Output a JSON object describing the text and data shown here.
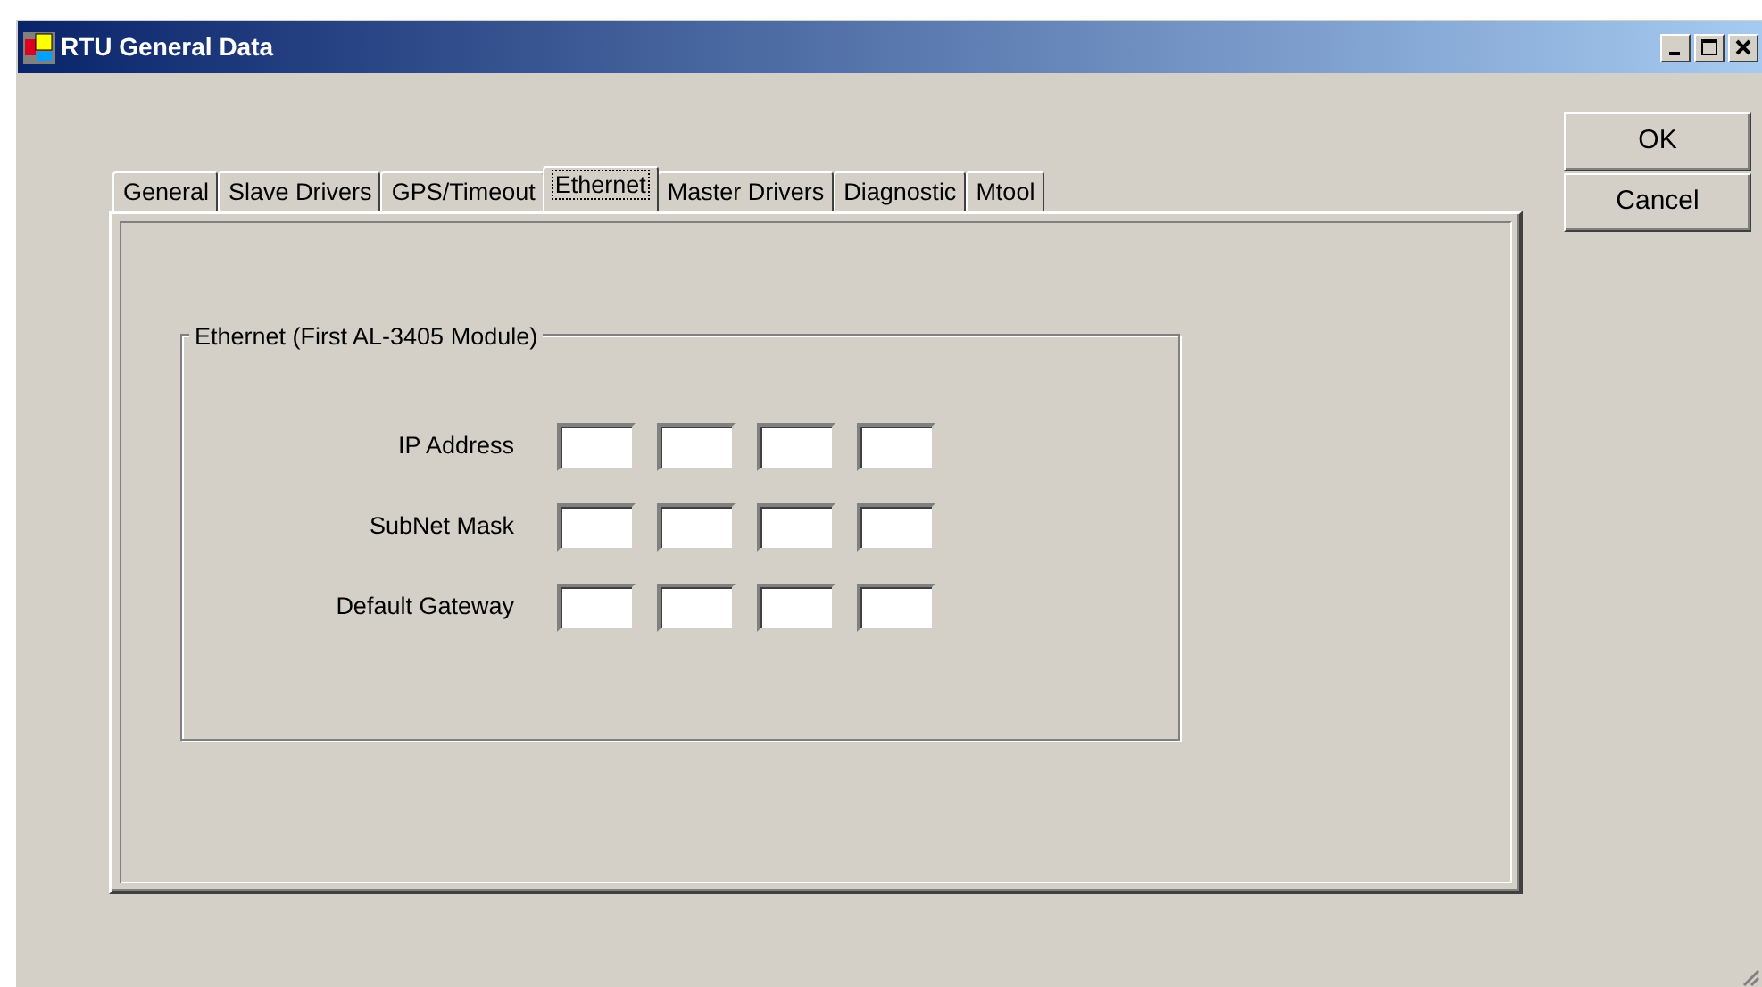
{
  "window": {
    "title": "RTU General Data"
  },
  "tabs": [
    {
      "label": "General",
      "selected": false
    },
    {
      "label": "Slave Drivers",
      "selected": false
    },
    {
      "label": "GPS/Timeout",
      "selected": false
    },
    {
      "label": "Ethernet",
      "selected": true
    },
    {
      "label": "Master Drivers",
      "selected": false
    },
    {
      "label": "Diagnostic",
      "selected": false
    },
    {
      "label": "Mtool",
      "selected": false
    }
  ],
  "group": {
    "title": "Ethernet (First AL-3405 Module)",
    "rows": [
      {
        "label": "IP Address"
      },
      {
        "label": "SubNet Mask"
      },
      {
        "label": "Default Gateway"
      }
    ]
  },
  "buttons": [
    "OK",
    "Cancel"
  ]
}
